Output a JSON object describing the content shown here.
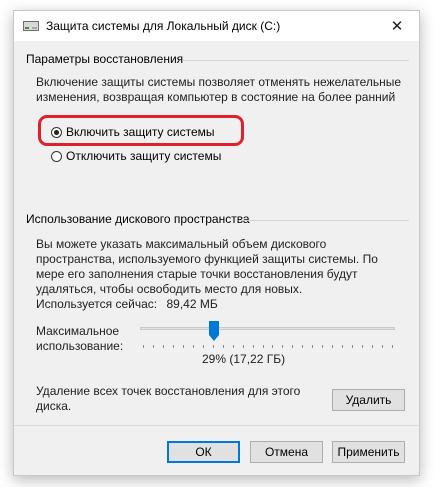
{
  "window": {
    "title": "Защита системы для Локальный диск (C:)",
    "close_glyph": "✕"
  },
  "restore_settings": {
    "header": "Параметры восстановления",
    "description": "Включение защиты системы позволяет отменять нежелательные изменения, возвращая компьютер в состояние на более ранний момент времени.",
    "options": [
      {
        "label": "Включить защиту системы",
        "selected": true
      },
      {
        "label": "Отключить защиту системы",
        "selected": false
      }
    ]
  },
  "disk_usage": {
    "header": "Использование дискового пространства",
    "description": "Вы можете указать максимальный объем дискового пространства, используемого функцией защиты системы. По мере его заполнения старые точки восстановления будут удаляться, чтобы освободить место для новых.",
    "current_usage_label": "Используется сейчас:",
    "current_usage_value": "89,42 МБ",
    "max_usage_label": "Максимальное использование:",
    "slider_percent": 29,
    "slider_value_text": "29% (17,22 ГБ)",
    "delete_text": "Удаление всех точек восстановления для этого диска.",
    "delete_button": "Удалить"
  },
  "footer": {
    "ok": "ОК",
    "cancel": "Отмена",
    "apply": "Применить"
  },
  "colors": {
    "highlight": "#e0202a",
    "slider_thumb": "#0078d7"
  }
}
